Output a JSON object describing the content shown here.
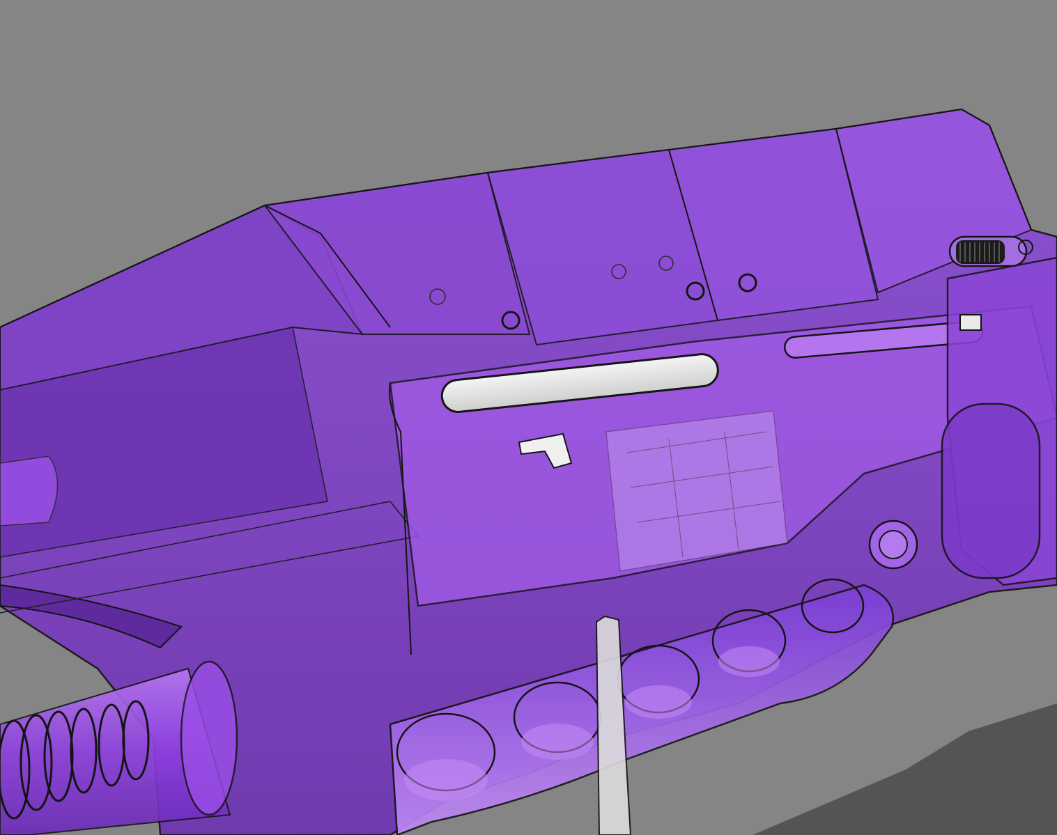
{
  "viewport": {
    "background_color": "#858585",
    "shadow_color": "#4f4f4f",
    "body_color": "#7b3fc0",
    "body_light_color": "#a055e6",
    "edge_color": "#141414",
    "ghost_part_color": "#e6e6e6",
    "display_mode": "shaded-with-edges-transparent"
  },
  "model": {
    "parts": [
      {
        "id": "upper-receiver",
        "icon": "receiver-shell-icon"
      },
      {
        "id": "top-rail-segments",
        "icon": "rail-segment-icon"
      },
      {
        "id": "charging-slot",
        "icon": "slot-icon"
      },
      {
        "id": "magazine-well",
        "icon": "magazine-icon"
      },
      {
        "id": "barrel-tube",
        "icon": "barrel-icon"
      },
      {
        "id": "trigger-blade",
        "icon": "trigger-icon"
      },
      {
        "id": "grip-wheel",
        "icon": "knurled-wheel-icon"
      },
      {
        "id": "pivot-pin",
        "icon": "pin-icon"
      }
    ]
  }
}
